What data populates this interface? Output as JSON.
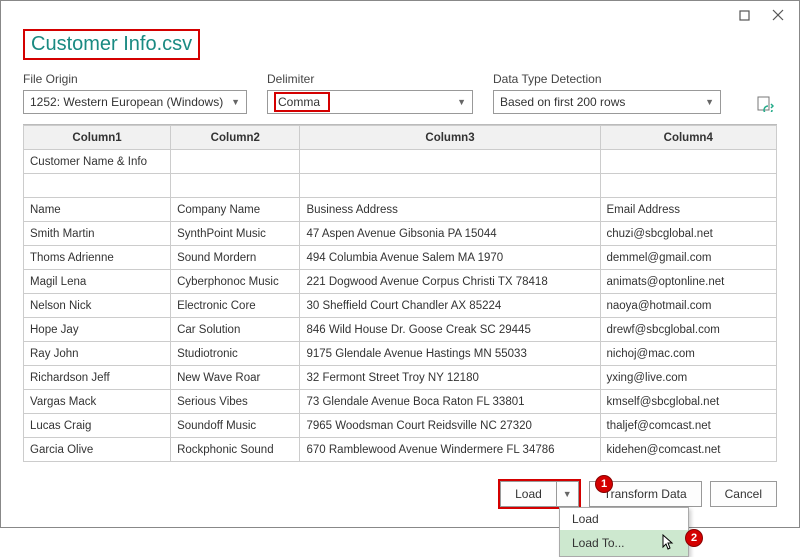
{
  "title": "Customer Info.csv",
  "labels": {
    "file_origin": "File Origin",
    "delimiter": "Delimiter",
    "detection": "Data Type Detection"
  },
  "selects": {
    "file_origin": "1252: Western European (Windows)",
    "delimiter": "Comma",
    "detection": "Based on first 200 rows"
  },
  "columns": [
    "Column1",
    "Column2",
    "Column3",
    "Column4"
  ],
  "rows": [
    [
      "Customer Name & Info",
      "",
      "",
      ""
    ],
    [
      "",
      "",
      "",
      ""
    ],
    [
      "Name",
      "Company Name",
      "Business Address",
      "Email Address"
    ],
    [
      "Smith Martin",
      "SynthPoint Music",
      "47 Aspen Avenue Gibsonia PA 15044",
      "chuzi@sbcglobal.net"
    ],
    [
      "Thoms Adrienne",
      "Sound Mordern",
      "494 Columbia Avenue Salem MA 1970",
      "demmel@gmail.com"
    ],
    [
      "Magil Lena",
      "Cyberphonoc Music",
      "221 Dogwood Avenue Corpus Christi TX 78418",
      "animats@optonline.net"
    ],
    [
      "Nelson Nick",
      "Electronic Core",
      "30 Sheffield Court Chandler AX 85224",
      "naoya@hotmail.com"
    ],
    [
      "Hope Jay",
      "Car Solution",
      "846 Wild House Dr. Goose Creak SC 29445",
      "drewf@sbcglobal.com"
    ],
    [
      "Ray John",
      "Studiotronic",
      "9175 Glendale Avenue Hastings MN 55033",
      "nichoj@mac.com"
    ],
    [
      "Richardson Jeff",
      "New Wave Roar",
      "32 Fermont Street Troy NY 12180",
      "yxing@live.com"
    ],
    [
      "Vargas Mack",
      "Serious Vibes",
      "73 Glendale Avenue Boca Raton FL 33801",
      "kmself@sbcglobal.net"
    ],
    [
      "Lucas Craig",
      "Soundoff Music",
      "7965 Woodsman Court Reidsville NC 27320",
      "thaljef@comcast.net"
    ],
    [
      "Garcia Olive",
      "Rockphonic Sound",
      "670 Ramblewood Avenue Windermere FL 34786",
      "kidehen@comcast.net"
    ]
  ],
  "buttons": {
    "load": "Load",
    "transform": "Transform Data",
    "cancel": "Cancel"
  },
  "menu": {
    "item1": "Load",
    "item2": "Load To..."
  },
  "annotations": {
    "b1": "1",
    "b2": "2"
  },
  "chart_data": {
    "type": "table",
    "title": "Customer Info.csv",
    "columns": [
      "Column1",
      "Column2",
      "Column3",
      "Column4"
    ],
    "rows": [
      [
        "Customer Name & Info",
        "",
        "",
        ""
      ],
      [
        "",
        "",
        "",
        ""
      ],
      [
        "Name",
        "Company Name",
        "Business Address",
        "Email Address"
      ],
      [
        "Smith Martin",
        "SynthPoint Music",
        "47 Aspen Avenue Gibsonia PA 15044",
        "chuzi@sbcglobal.net"
      ],
      [
        "Thoms Adrienne",
        "Sound Mordern",
        "494 Columbia Avenue Salem MA 1970",
        "demmel@gmail.com"
      ],
      [
        "Magil Lena",
        "Cyberphonoc Music",
        "221 Dogwood Avenue Corpus Christi TX 78418",
        "animats@optonline.net"
      ],
      [
        "Nelson Nick",
        "Electronic Core",
        "30 Sheffield Court Chandler AX 85224",
        "naoya@hotmail.com"
      ],
      [
        "Hope Jay",
        "Car Solution",
        "846 Wild House Dr. Goose Creak SC 29445",
        "drewf@sbcglobal.com"
      ],
      [
        "Ray John",
        "Studiotronic",
        "9175 Glendale Avenue Hastings MN 55033",
        "nichoj@mac.com"
      ],
      [
        "Richardson Jeff",
        "New Wave Roar",
        "32 Fermont Street Troy NY 12180",
        "yxing@live.com"
      ],
      [
        "Vargas Mack",
        "Serious Vibes",
        "73 Glendale Avenue Boca Raton FL 33801",
        "kmself@sbcglobal.net"
      ],
      [
        "Lucas Craig",
        "Soundoff Music",
        "7965 Woodsman Court Reidsville NC 27320",
        "thaljef@comcast.net"
      ],
      [
        "Garcia Olive",
        "Rockphonic Sound",
        "670 Ramblewood Avenue Windermere FL 34786",
        "kidehen@comcast.net"
      ]
    ]
  }
}
